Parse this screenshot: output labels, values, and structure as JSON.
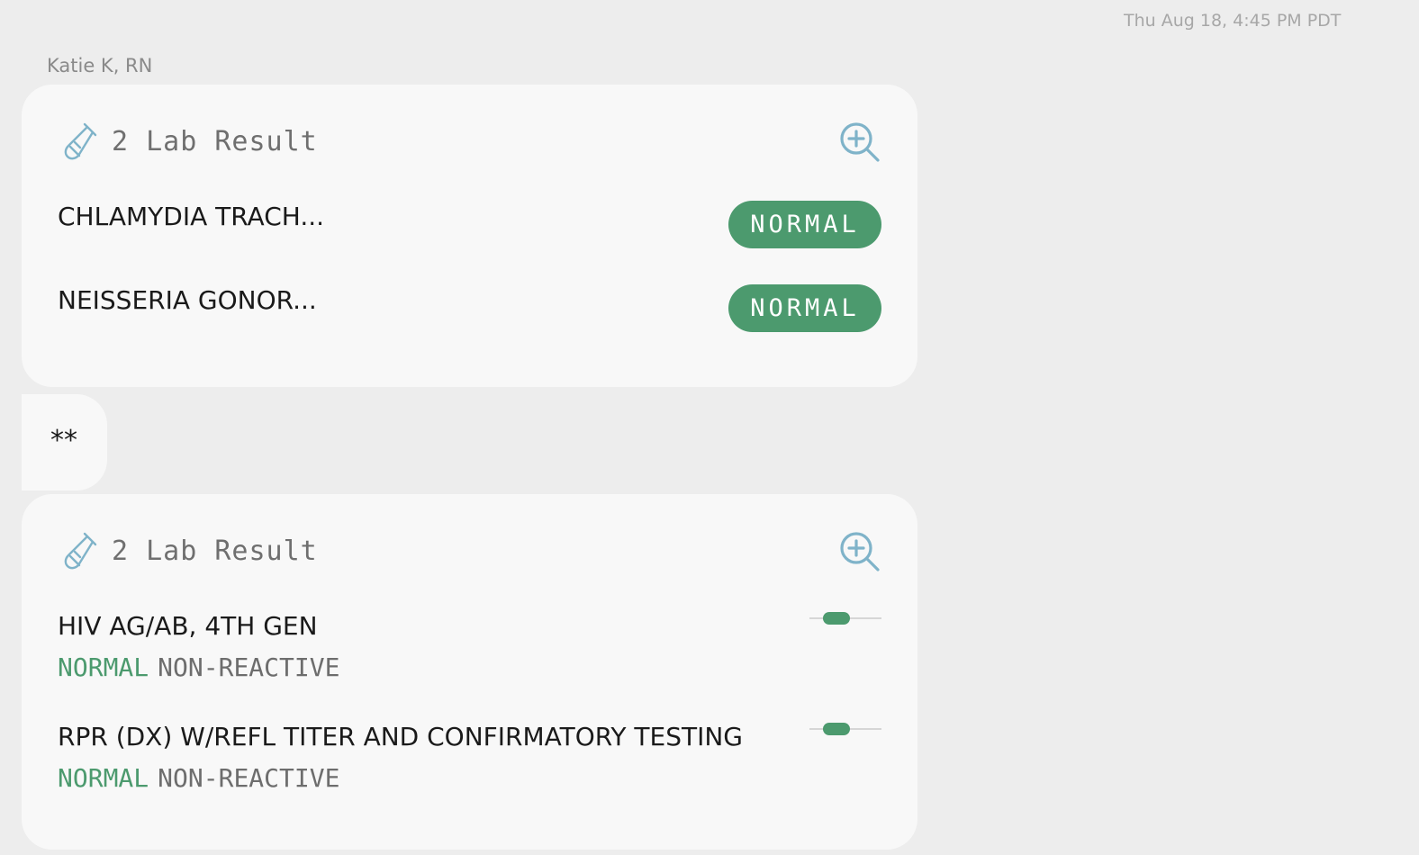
{
  "timestamp": "Thu Aug 18, 4:45 PM PDT",
  "sender": "Katie K, RN",
  "colors": {
    "background": "#ededed",
    "card": "#f8f8f8",
    "normal_green": "#4c9a6e",
    "icon_blue": "#7fb3c9"
  },
  "cards": [
    {
      "icon": "test-tube-icon",
      "title": "2 Lab Result",
      "zoom_icon": "zoom-in-icon",
      "results": [
        {
          "name": "CHLAMYDIA TRACH...",
          "badge": "NORMAL"
        },
        {
          "name": "NEISSERIA GONOR...",
          "badge": "NORMAL"
        }
      ]
    },
    {
      "icon": "test-tube-icon",
      "title": "2 Lab Result",
      "zoom_icon": "zoom-in-icon",
      "results": [
        {
          "name": "HIV AG/AB, 4TH GEN",
          "status": "NORMAL",
          "value": "NON-REACTIVE",
          "range_position": 0.37
        },
        {
          "name": "RPR (DX) W/REFL TITER AND CONFIRMATORY TESTING",
          "status": "NORMAL",
          "value": "NON-REACTIVE",
          "range_position": 0.37
        }
      ]
    }
  ],
  "note": {
    "text": "**"
  }
}
